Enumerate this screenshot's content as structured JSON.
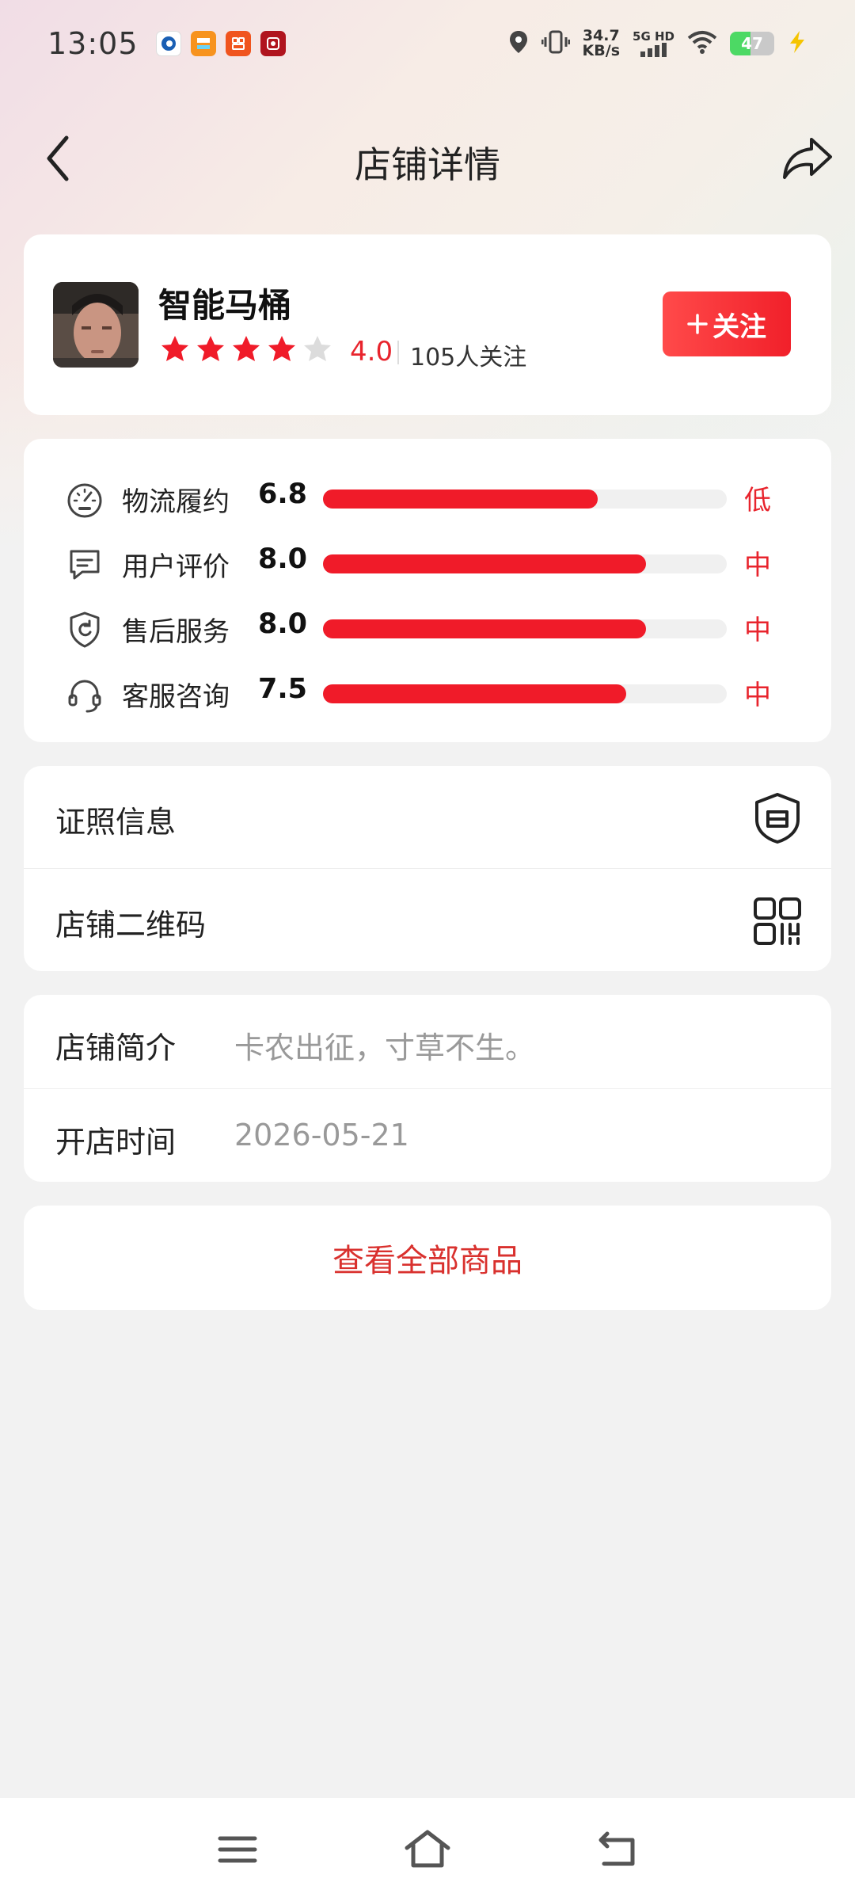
{
  "status_bar": {
    "time": "13:05",
    "net_speed_value": "34.7",
    "net_speed_unit": "KB/s",
    "network": "5G HD",
    "battery": "47",
    "battery_level": 0.47,
    "icons": [
      "app-icon-1",
      "app-icon-2",
      "app-icon-3",
      "app-icon-4",
      "location-icon",
      "vibrate-icon",
      "signal-icon",
      "wifi-icon",
      "battery-icon",
      "charging-icon"
    ]
  },
  "nav": {
    "title": "店铺详情"
  },
  "shop": {
    "name": "智能马桶",
    "rating": "4.0",
    "rating_value": 4.0,
    "rating_max": 5,
    "followers": "105人关注",
    "follow_button": "关注"
  },
  "scores": [
    {
      "label": "物流履约",
      "value": "6.8",
      "level": "低",
      "fraction": 0.68,
      "icon": "speedometer-icon"
    },
    {
      "label": "用户评价",
      "value": "8.0",
      "level": "中",
      "fraction": 0.8,
      "icon": "comment-icon"
    },
    {
      "label": "售后服务",
      "value": "8.0",
      "level": "中",
      "fraction": 0.8,
      "icon": "shield-refresh-icon"
    },
    {
      "label": "客服咨询",
      "value": "7.5",
      "level": "中",
      "fraction": 0.75,
      "icon": "headset-icon"
    }
  ],
  "links": [
    {
      "label": "证照信息",
      "icon": "license-shield-icon"
    },
    {
      "label": "店铺二维码",
      "icon": "qrcode-icon"
    }
  ],
  "info": [
    {
      "label": "店铺简介",
      "value": "卡农出征，寸草不生。"
    },
    {
      "label": "开店时间",
      "value": "2026-05-21"
    }
  ],
  "view_all": "查看全部商品",
  "colors": {
    "accent": "#f01b29",
    "level_text": "#e8242d",
    "view_all_text": "#d9312e",
    "page_bg": "#f2f2f2"
  }
}
